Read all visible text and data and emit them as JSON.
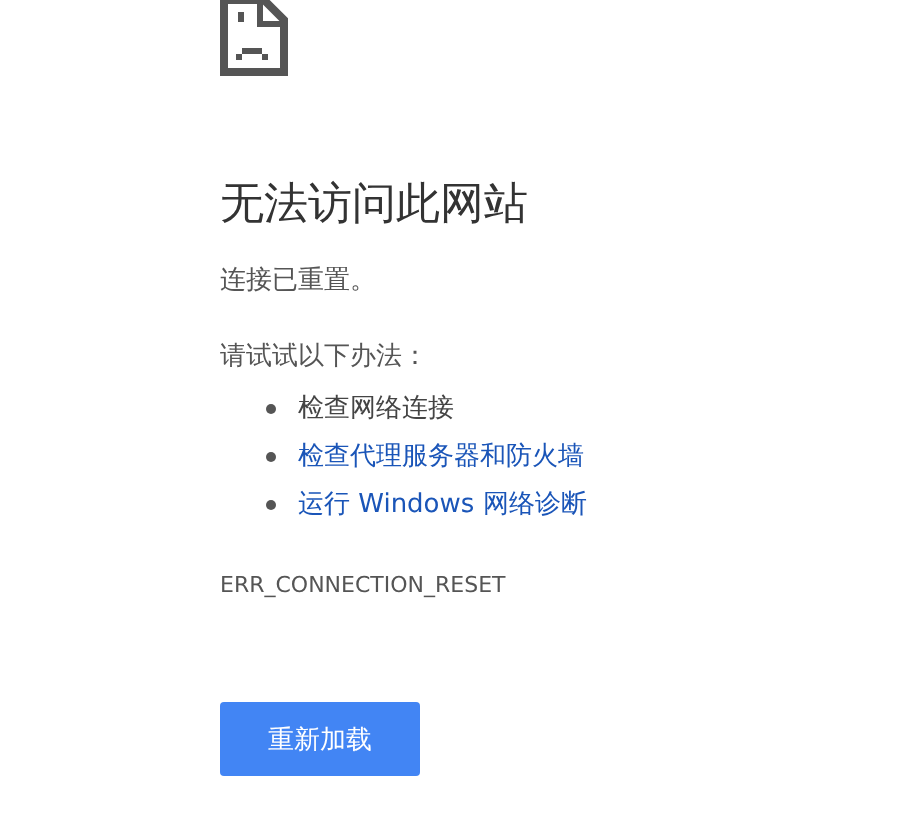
{
  "heading": "无法访问此网站",
  "message": "连接已重置。",
  "suggestions_intro": "请试试以下办法：",
  "suggestions": [
    {
      "label": "检查网络连接",
      "kind": "text"
    },
    {
      "label": "检查代理服务器和防火墙",
      "kind": "link"
    },
    {
      "label": "运行 Windows 网络诊断",
      "kind": "link"
    }
  ],
  "error_code": "ERR_CONNECTION_RESET",
  "button": "重新加载"
}
